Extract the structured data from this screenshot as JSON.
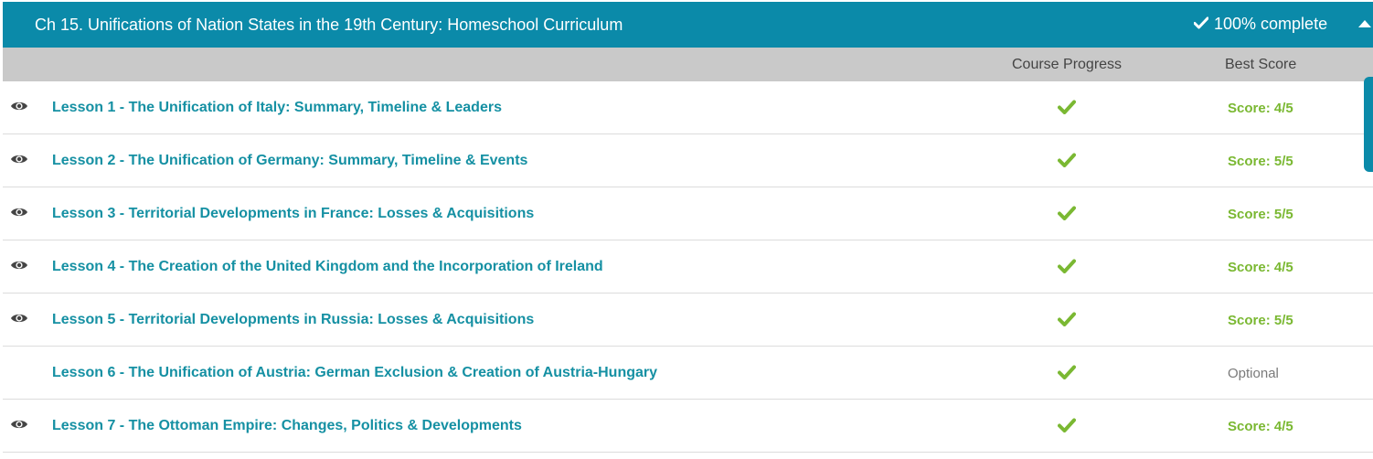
{
  "chapter": {
    "title": "Ch 15. Unifications of Nation States in the 19th Century: Homeschool Curriculum",
    "progress_text": "100% complete",
    "progress_value": 1.0
  },
  "columns": {
    "course_progress": "Course Progress",
    "best_score": "Best Score"
  },
  "lessons": [
    {
      "label": "Lesson 1 - The Unification of Italy: Summary, Timeline & Leaders",
      "score": "Score: 4/5",
      "viewed": true
    },
    {
      "label": "Lesson 2 - The Unification of Germany: Summary, Timeline & Events",
      "score": "Score: 5/5",
      "viewed": true
    },
    {
      "label": "Lesson 3 - Territorial Developments in France: Losses & Acquisitions",
      "score": "Score: 5/5",
      "viewed": true
    },
    {
      "label": "Lesson 4 - The Creation of the United Kingdom and the Incorporation of Ireland",
      "score": "Score: 4/5",
      "viewed": true
    },
    {
      "label": "Lesson 5 - Territorial Developments in Russia: Losses & Acquisitions",
      "score": "Score: 5/5",
      "viewed": true
    },
    {
      "label": "Lesson 6 - The Unification of Austria: German Exclusion & Creation of Austria-Hungary",
      "score": "Optional",
      "viewed": false
    },
    {
      "label": "Lesson 7 - The Ottoman Empire: Changes, Politics & Developments",
      "score": "Score: 4/5",
      "viewed": true
    }
  ],
  "colors": {
    "header_bg": "#0b8aa9",
    "link": "#1590a3",
    "check": "#7ab832",
    "score_green": "#7ab832",
    "optional_gray": "#7a7a7a",
    "column_header_bg": "#c9c9c9"
  },
  "icons": {
    "viewed": "eye-icon",
    "complete": "checkmark-icon",
    "collapse": "caret-up-icon"
  }
}
